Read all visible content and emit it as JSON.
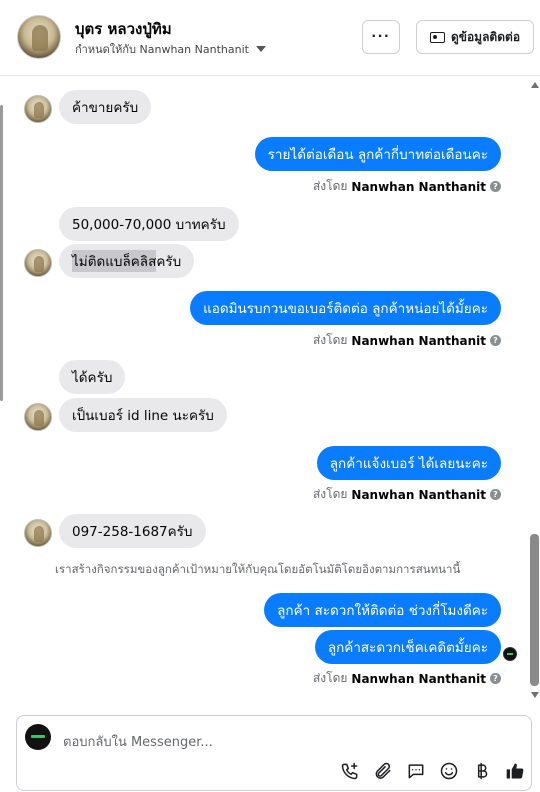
{
  "header": {
    "name": "บุตร หลวงปู่ทิม",
    "assigned_to": "กำหนดให้กับ Nanwhan Nanthanit",
    "more_label": "···",
    "contact_label": "ดูข้อมูลติดต่อ"
  },
  "messages": [
    {
      "dir": "in",
      "text": "ค้าขายครับ"
    },
    {
      "dir": "out",
      "text": "รายได้ต่อเดือน ลูกค้ากี่บาทต่อเดือนคะ"
    },
    {
      "dir": "in",
      "text": "50,000-70,000 บาทครับ"
    },
    {
      "dir": "in",
      "text": "ไม่ติดแบล็คลิสครับ",
      "highlight": "ไม่ติดแบล็คลิส"
    },
    {
      "dir": "out",
      "text": "แอดมินรบกวนขอเบอร์ติดต่อ ลูกค้าหน่อยได้มั้ยคะ"
    },
    {
      "dir": "in",
      "text": "ได้ครับ"
    },
    {
      "dir": "in",
      "text": "เป็นเบอร์ id line นะครับ"
    },
    {
      "dir": "out",
      "text": "ลูกค้าแจ้งเบอร์ ได้เลยนะคะ"
    },
    {
      "dir": "in",
      "text": "097-258-1687ครับ"
    },
    {
      "dir": "out",
      "text": "ลูกค้า สะดวกให้ติดต่อ ช่วงกี่โมงดีคะ"
    },
    {
      "dir": "out",
      "text": "ลูกค้าสะดวกเช็คเคดิตมั้ยคะ"
    }
  ],
  "sent_by": {
    "prefix": "ส่งโดย",
    "name": "Nanwhan Nanthanit"
  },
  "notice": "เราสร้างกิจกรรมของลูกค้าเป้าหมายให้กับคุณโดยอัตโนมัติโดยอิงตามการสนทนานี้",
  "composer": {
    "placeholder": "ตอบกลับใน Messenger...",
    "tools": [
      "phone-plus-icon",
      "attachment-icon",
      "saved-reply-icon",
      "emoji-icon",
      "baht-icon",
      "like-icon"
    ]
  },
  "colors": {
    "outgoing": "#0a7cff",
    "incoming": "#e9e9ec"
  }
}
